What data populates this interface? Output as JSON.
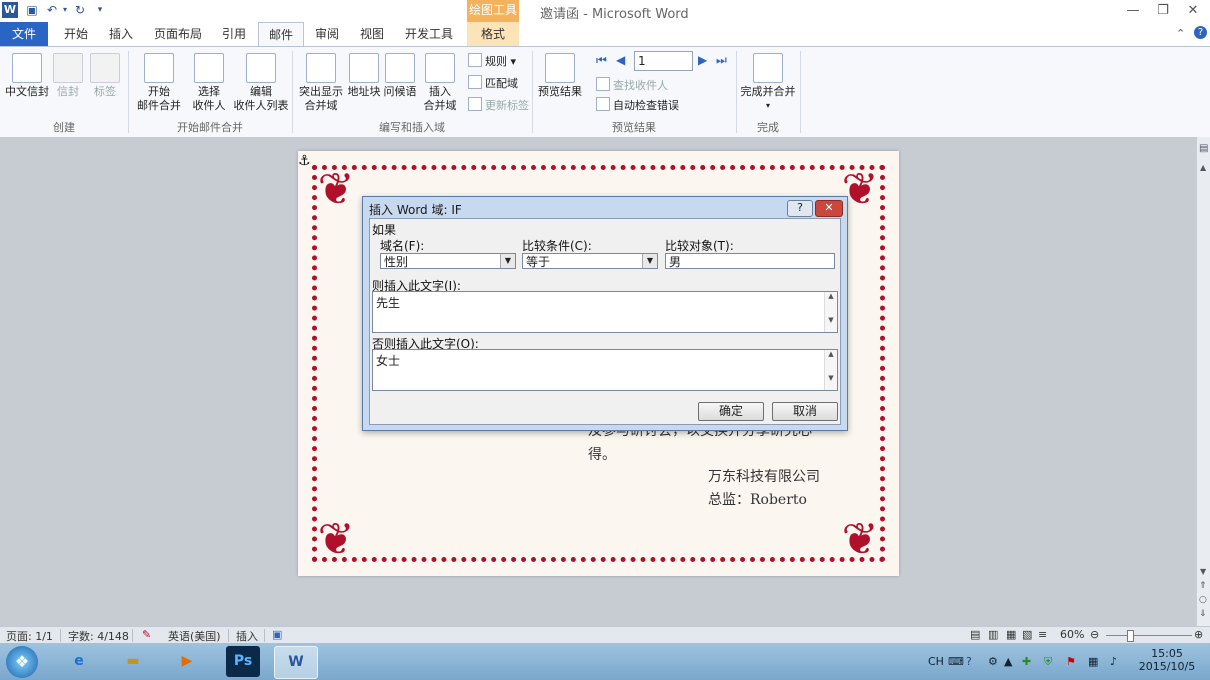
{
  "window": {
    "title": "邀请函 - Microsoft Word",
    "context_tab_title": "绘图工具"
  },
  "tabs": [
    "文件",
    "开始",
    "插入",
    "页面布局",
    "引用",
    "邮件",
    "审阅",
    "视图",
    "开发工具",
    "格式"
  ],
  "ribbon": {
    "groups": {
      "create": "创建",
      "start_merge": "开始邮件合并",
      "write_insert": "编写和插入域",
      "preview": "预览结果",
      "finish": "完成"
    },
    "buttons": {
      "chinese_envelope": "中文信封",
      "envelope": "信封",
      "labels": "标签",
      "start_merge_1": "开始",
      "start_merge_2": "邮件合并",
      "select_recipients_1": "选择",
      "select_recipients_2": "收件人",
      "edit_list_1": "编辑",
      "edit_list_2": "收件人列表",
      "highlight_1": "突出显示",
      "highlight_2": "合并域",
      "address_block": "地址块",
      "greeting_line": "问候语",
      "insert_field_1": "插入",
      "insert_field_2": "合并域",
      "rules": "规则",
      "match_fields": "匹配域",
      "update_labels": "更新标签",
      "preview_results": "预览结果",
      "record_number": "1",
      "find_recipient": "查找收件人",
      "auto_check": "自动检查错误",
      "finish_merge": "完成并合并"
    }
  },
  "document": {
    "line_partial": "及参与研讨会，以交换并分享研究心",
    "line_end": "得。",
    "company": "万东科技有限公司",
    "director": "总监：Roberto"
  },
  "dialog": {
    "title": "插入 Word 域: IF",
    "help": "?",
    "if_label": "如果",
    "field_name_label": "域名(F):",
    "field_name_value": "性别",
    "comparison_label": "比较条件(C):",
    "comparison_value": "等于",
    "compare_to_label": "比较对象(T):",
    "compare_to_value": "男",
    "insert_text_label": "则插入此文字(I):",
    "insert_text_value": "先生",
    "otherwise_label": "否则插入此文字(O):",
    "otherwise_value": "女士",
    "ok": "确定",
    "cancel": "取消"
  },
  "status": {
    "page": "页面: 1/1",
    "words": "字数: 4/148",
    "language": "英语(美国)",
    "mode": "插入",
    "zoom": "60%"
  },
  "taskbar": {
    "time": "15:05",
    "date": "2015/10/5",
    "ime": "CH"
  },
  "colors": {
    "accent": "#2b65c4",
    "border_red": "#b0102a",
    "context_tab": "#f3b25b"
  }
}
